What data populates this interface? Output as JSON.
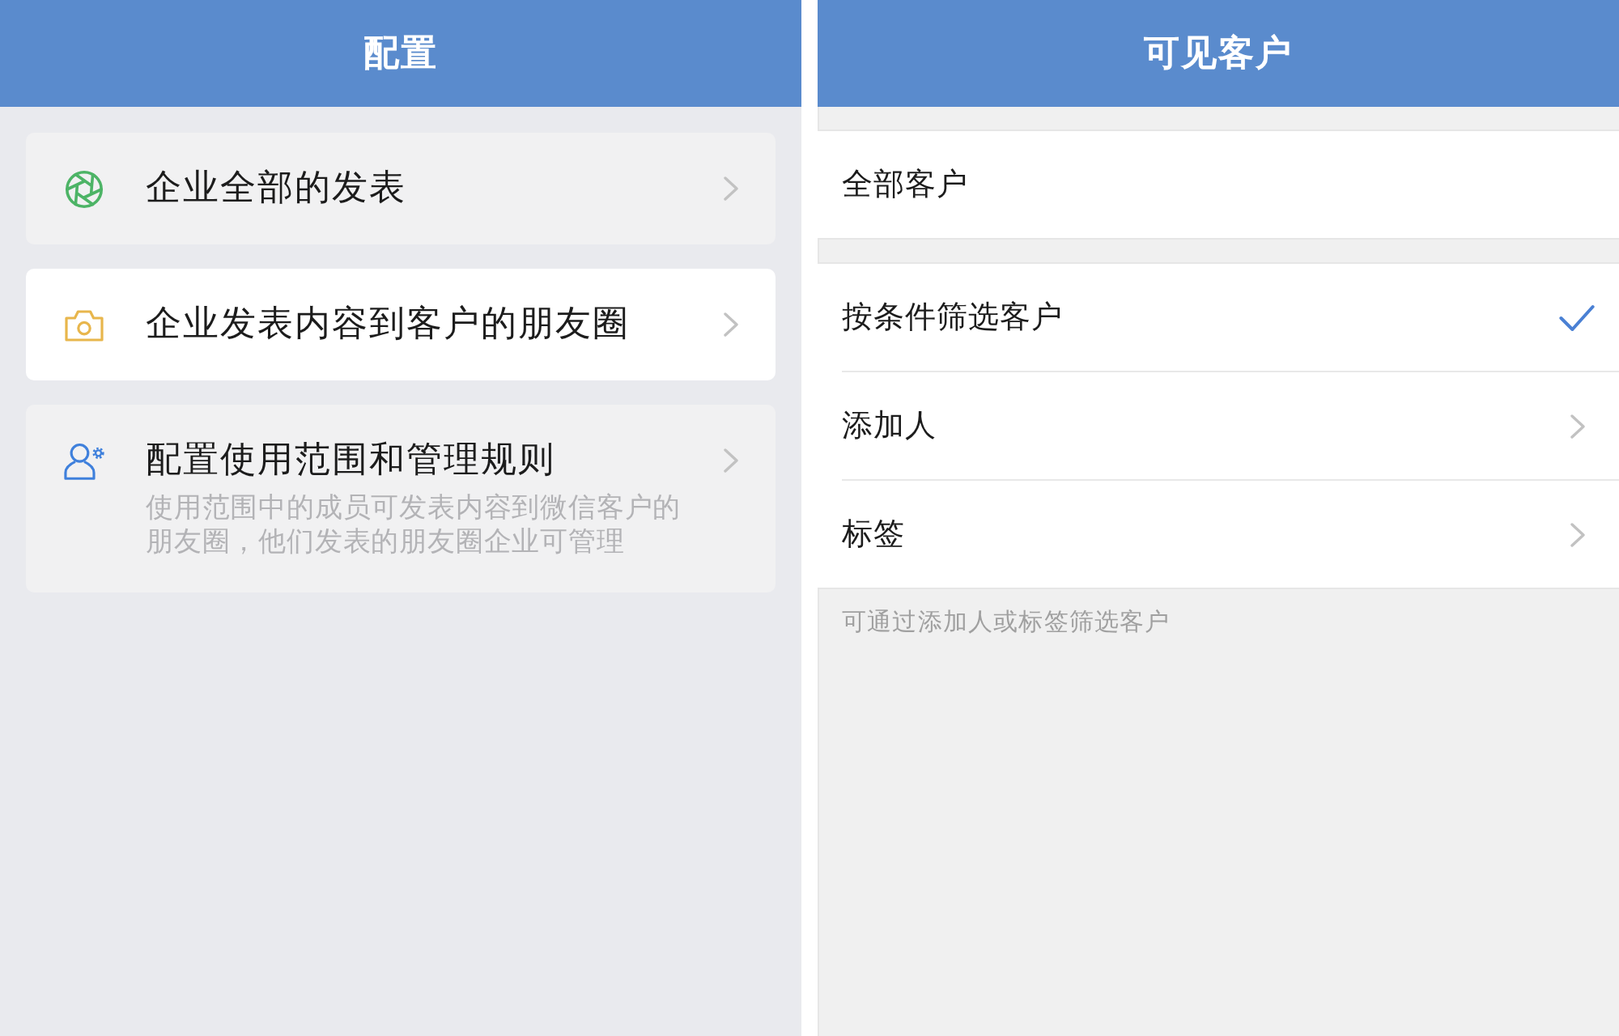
{
  "left_panel": {
    "header": {
      "title": "配置"
    },
    "items": [
      {
        "title": "企业全部的发表",
        "selected": false
      },
      {
        "title": "企业发表内容到客户的朋友圈",
        "selected": true
      },
      {
        "title": "配置使用范围和管理规则",
        "description": "使用范围中的成员可发表内容到微信客户的朋友圈，他们发表的朋友圈企业可管理",
        "selected": false
      }
    ]
  },
  "right_panel": {
    "header": {
      "title": "可见客户"
    },
    "groups": [
      {
        "rows": [
          {
            "kind": "option",
            "label": "全部客户",
            "selected": false
          }
        ]
      },
      {
        "rows": [
          {
            "kind": "option",
            "label": "按条件筛选客户",
            "selected": true
          },
          {
            "kind": "link",
            "label": "添加人"
          },
          {
            "kind": "link",
            "label": "标签"
          }
        ]
      }
    ],
    "hint": "可通过添加人或标签筛选客户"
  }
}
